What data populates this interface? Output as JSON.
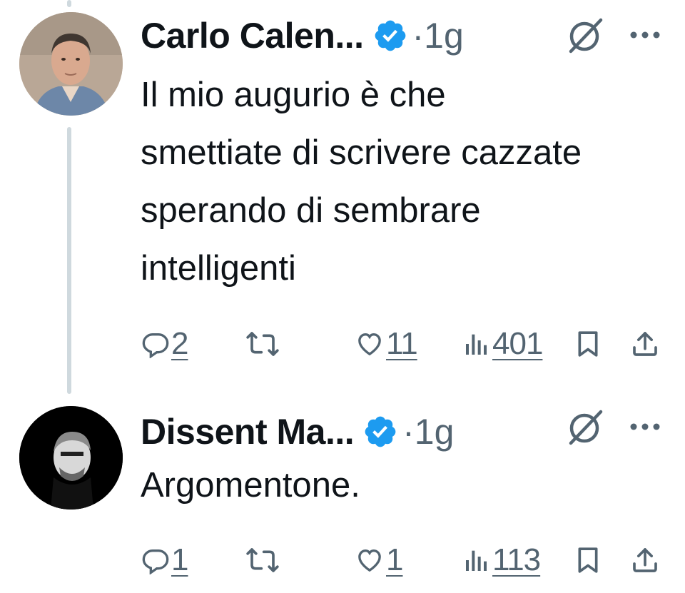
{
  "tweets": [
    {
      "author": "Carlo Calen...",
      "verified": true,
      "time": "·1g",
      "text": "Il mio augurio è che smettiate di scrivere cazzate sperando di sembrare intelligenti",
      "replies": "2",
      "likes": "11",
      "views": "401"
    },
    {
      "author": "Dissent Ma...",
      "verified": true,
      "time": "·1g",
      "text": "Argomentone.",
      "replies": "1",
      "likes": "1",
      "views": "113"
    }
  ],
  "colors": {
    "text": "#0f1419",
    "muted": "#536471",
    "verified": "#1d9bf0",
    "thread": "#cfd9de"
  },
  "icons": [
    "verified-badge-icon",
    "grok-icon",
    "more-icon",
    "reply-icon",
    "retweet-icon",
    "like-icon",
    "views-icon",
    "bookmark-icon",
    "share-icon"
  ]
}
